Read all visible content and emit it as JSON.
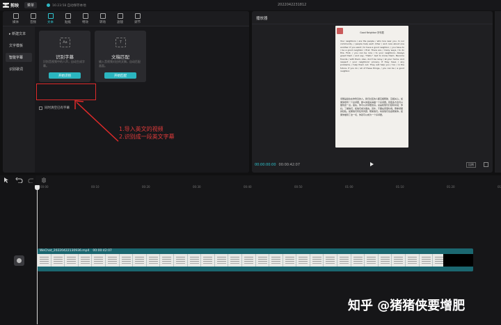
{
  "topbar": {
    "app_name": "剪映",
    "menu_label": "菜单",
    "save_status": "16:23:58 自动保存本地",
    "project_title": "2022042231812"
  },
  "toolbar": {
    "tabs": [
      {
        "label": "媒体",
        "icon": "media-icon"
      },
      {
        "label": "音频",
        "icon": "audio-icon"
      },
      {
        "label": "文本",
        "icon": "text-icon"
      },
      {
        "label": "贴纸",
        "icon": "sticker-icon"
      },
      {
        "label": "特效",
        "icon": "effects-icon"
      },
      {
        "label": "转场",
        "icon": "transition-icon"
      },
      {
        "label": "滤镜",
        "icon": "filter-icon"
      },
      {
        "label": "调节",
        "icon": "adjust-icon"
      }
    ],
    "active_index": 2
  },
  "sidebar": {
    "items": [
      {
        "label": "▸ 新建文本"
      },
      {
        "label": "文字模板"
      },
      {
        "label": "智能字幕"
      },
      {
        "label": "识别歌词"
      }
    ],
    "active_index": 2
  },
  "cards": [
    {
      "title": "识别字幕",
      "desc": "识别音视频中的人声，自动生成字幕。",
      "button": "开始识别",
      "icon": "Aa"
    },
    {
      "title": "文稿匹配",
      "desc": "输入音视频对应的文稿，自动匹配画面。",
      "button": "开始匹配",
      "icon": "T"
    }
  ],
  "clear_checkbox": "同时清空已有字幕",
  "annotation": {
    "line1": "1.导入英文的视频",
    "line2": "2.识别成一段英文字幕"
  },
  "player": {
    "title": "播放器",
    "current_time": "00:00:00:00",
    "total_time": "00:00:42:07",
    "ratio_label": "比例"
  },
  "preview_doc": {
    "title": "Good Neighbor  好邻居",
    "body": "Your neighbors / are the people / who live near you. In our community, / people help each other / and care about one another. If you want / to have a good neighbor, / you have to / be a good neighbor / first. There are / many ways / to do this. First, / you can be nice / to your neighbors. Always greet them / and say, \"Hello.\" Get to know them. Become friends / with them. Also, don't be noisy / at your home. And respect / your neighbors' privacy. If they have / any problems, / help them out. They will help you / too / in the future. If you do / all of these things, / you can be / a good neighbor.",
    "chinese": "邻居是指住在你附近的人。我们社区的人都互相帮助、互相关心。如果你想有一个好邻居，那么你首先得做一个好邻居。有很多方法可以做到这一点。首先，你可以对邻居友好。总是和他们打招呼并说：你好。了解他们，和他们成为朋友。另外，不要在家里吵闹。尊重邻居的隐私。如果他们有任何问题，帮助他们。将来他们也会帮助你。如果你做到了这一切，你就可以成为一个好邻居。"
  },
  "timeline": {
    "ruler_ticks": [
      "00:00",
      "00:10",
      "00:20",
      "00:30",
      "00:40",
      "00:50",
      "01:00",
      "01:10",
      "01:20",
      "01:30"
    ],
    "clip_name": "WeChat_20220422130936.mp4",
    "clip_duration": "00:00:42:07"
  },
  "watermark": "知乎 @猪猪侠要增肥",
  "colors": {
    "accent": "#2fc6d0",
    "annotation": "#e02a2a",
    "clip": "#1b6770"
  }
}
